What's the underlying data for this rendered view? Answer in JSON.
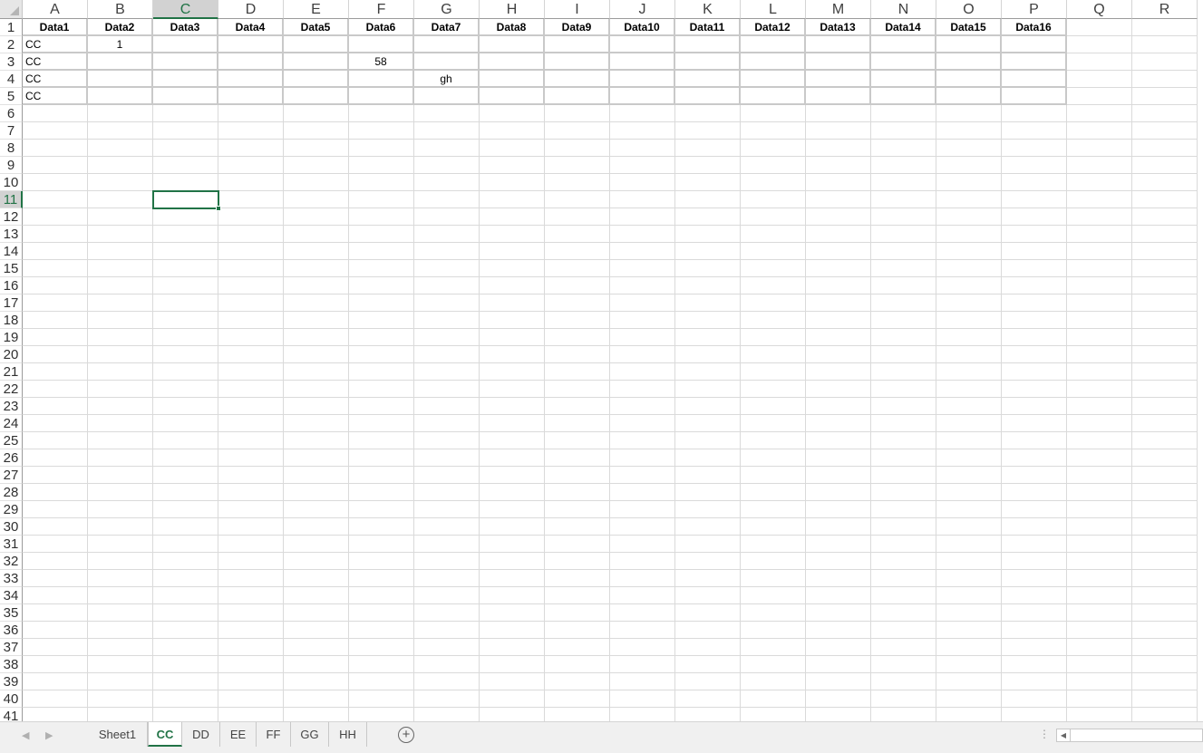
{
  "sheet": {
    "columns": [
      "A",
      "B",
      "C",
      "D",
      "E",
      "F",
      "G",
      "H",
      "I",
      "J",
      "K",
      "L",
      "M",
      "N",
      "O",
      "P",
      "Q",
      "R"
    ],
    "selected_column": "C",
    "rows": [
      "1",
      "2",
      "3",
      "4",
      "5",
      "6",
      "7",
      "8",
      "9",
      "10",
      "11",
      "12",
      "13",
      "14",
      "15",
      "16",
      "17",
      "18",
      "19",
      "20",
      "21",
      "22",
      "23",
      "24",
      "25",
      "26",
      "27",
      "28",
      "29",
      "30",
      "31",
      "32",
      "33",
      "34",
      "35",
      "36",
      "37",
      "38",
      "39",
      "40",
      "41"
    ],
    "selected_row": "11",
    "header_row": [
      "Data1",
      "Data2",
      "Data3",
      "Data4",
      "Data5",
      "Data6",
      "Data7",
      "Data8",
      "Data9",
      "Data10",
      "Data11",
      "Data12",
      "Data13",
      "Data14",
      "Data15",
      "Data16"
    ],
    "data_rows": [
      [
        "CC",
        "1",
        "",
        "",
        "",
        "",
        "",
        "",
        "",
        "",
        "",
        "",
        "",
        "",
        "",
        ""
      ],
      [
        "CC",
        "",
        "",
        "",
        "",
        "58",
        "",
        "",
        "",
        "",
        "",
        "",
        "",
        "",
        "",
        ""
      ],
      [
        "CC",
        "",
        "",
        "",
        "",
        "",
        "gh",
        "",
        "",
        "",
        "",
        "",
        "",
        "",
        "",
        ""
      ],
      [
        "CC",
        "",
        "",
        "",
        "",
        "",
        "",
        "",
        "",
        "",
        "",
        "",
        "",
        "",
        "",
        ""
      ]
    ],
    "active_cell": "C11"
  },
  "tabs": {
    "items": [
      "Sheet1",
      "CC",
      "DD",
      "EE",
      "FF",
      "GG",
      "HH"
    ],
    "active": "CC",
    "add_icon": "plus-circle-icon"
  },
  "colors": {
    "accent": "#217346"
  }
}
